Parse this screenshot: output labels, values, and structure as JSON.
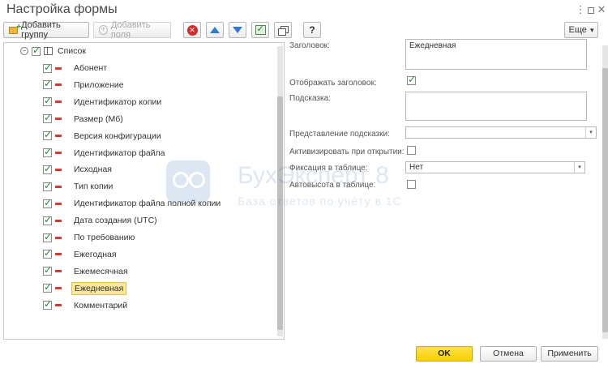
{
  "window": {
    "title": "Настройка формы",
    "menu_icon": "more-vertical-icon",
    "maximize_icon": "maximize-icon",
    "close_icon": "close-icon"
  },
  "toolbar": {
    "add_group": "Добавить группу",
    "add_fields": "Добавить поля",
    "more": "Еще",
    "more_arrow": "▾",
    "help": "?"
  },
  "tree": {
    "root_label": "Список",
    "items": [
      {
        "label": "Абонент",
        "checked": true
      },
      {
        "label": "Приложение",
        "checked": true
      },
      {
        "label": "Идентификатор копии",
        "checked": true
      },
      {
        "label": "Размер (Мб)",
        "checked": true
      },
      {
        "label": "Версия конфигурации",
        "checked": true
      },
      {
        "label": "Идентификатор файла",
        "checked": true
      },
      {
        "label": "Исходная",
        "checked": true
      },
      {
        "label": "Тип копии",
        "checked": true
      },
      {
        "label": "Идентификатор файла полной копии",
        "checked": true
      },
      {
        "label": "Дата создания (UTC)",
        "checked": true
      },
      {
        "label": "По требованию",
        "checked": true
      },
      {
        "label": "Ежегодная",
        "checked": true
      },
      {
        "label": "Ежемесячная",
        "checked": true
      },
      {
        "label": "Ежедневная",
        "checked": true,
        "selected": true
      },
      {
        "label": "Комментарий",
        "checked": true
      }
    ]
  },
  "properties": {
    "header_label": "Заголовок:",
    "header_value": "Ежедневная",
    "show_header_label": "Отображать заголовок:",
    "show_header_checked": true,
    "tooltip_label": "Подсказка:",
    "tooltip_value": "",
    "tooltip_repr_label": "Представление подсказки:",
    "tooltip_repr_value": "",
    "activate_label": "Активизировать при открытии:",
    "activate_checked": false,
    "fix_label": "Фиксация в таблице:",
    "fix_value": "Нет",
    "autoheight_label": "Автовысота в таблице:",
    "autoheight_checked": false
  },
  "watermark": {
    "brand": "БухЭксперт 8",
    "tagline": "База ответов по учёту в 1С"
  },
  "footer": {
    "ok": "OK",
    "cancel": "Отмена",
    "apply": "Применить"
  },
  "colors": {
    "primary_button": "#f7cf00",
    "selected_row": "#fbe89a",
    "check": "#1c8a2e",
    "remove_dash": "#d43a3a"
  }
}
